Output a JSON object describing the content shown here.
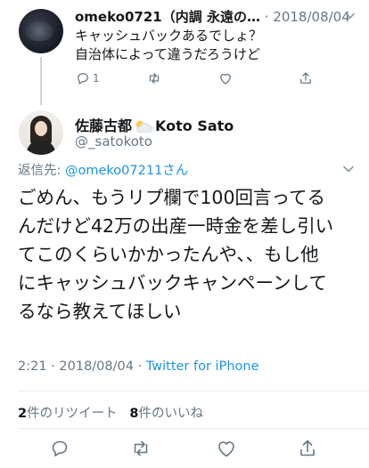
{
  "parent_tweet": {
    "author_name": "omeko0721（内調 永遠の…",
    "date": "2018/08/04",
    "text_line1": "キャッシュバックあるでしょ？",
    "text_line2": "自治体によって違うだろうけど",
    "reply_count": "1"
  },
  "main_tweet": {
    "author_name_part1": "佐藤古都",
    "author_name_part2": "Koto Sato",
    "handle": "@_satokoto",
    "reply_to_label": "返信先: ",
    "reply_to_handle": "@omeko0721",
    "reply_to_suffix": "1さん",
    "text_lines": [
      "ごめん、もうリプ欄で100回言ってる",
      "んだけど42万の出産一時金を差し引い",
      "てこのくらいかかったんや、、もし他",
      "にキャッシュバックキャンペーンして",
      "るなら教えてほしい"
    ],
    "time": "2:21",
    "date": "2018/08/04",
    "source": "Twitter for iPhone",
    "retweet_count": "2",
    "retweet_label": "件のリツイート",
    "like_count": "8",
    "like_label": "件のいいね"
  },
  "colors": {
    "text": "#14171a",
    "secondary": "#657786",
    "link": "#1b95e0",
    "divider": "#e6ecf0"
  },
  "icons": {
    "reply": "reply-icon",
    "retweet": "retweet-icon",
    "like": "heart-icon",
    "share": "share-icon",
    "cloud": "cloud-sun-icon"
  }
}
